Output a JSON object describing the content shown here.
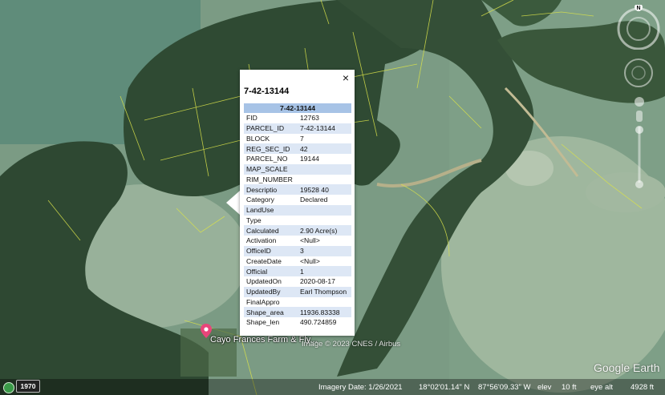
{
  "popup": {
    "title": "7-42-13144",
    "close_glyph": "×",
    "table_header": "7-42-13144",
    "rows": [
      {
        "key": "FID",
        "value": "12763"
      },
      {
        "key": "PARCEL_ID",
        "value": "7-42-13144"
      },
      {
        "key": "BLOCK",
        "value": "7"
      },
      {
        "key": "REG_SEC_ID",
        "value": "42"
      },
      {
        "key": "PARCEL_NO",
        "value": "19144"
      },
      {
        "key": "MAP_SCALE",
        "value": ""
      },
      {
        "key": "RIM_NUMBER",
        "value": ""
      },
      {
        "key": "Descriptio",
        "value": "19528 40"
      },
      {
        "key": "Category",
        "value": "Declared"
      },
      {
        "key": "LandUse",
        "value": ""
      },
      {
        "key": "Type",
        "value": ""
      },
      {
        "key": "Calculated",
        "value": "2.90 Acre(s)"
      },
      {
        "key": "Activation",
        "value": "<Null>"
      },
      {
        "key": "OfficeID",
        "value": "3"
      },
      {
        "key": "CreateDate",
        "value": "<Null>"
      },
      {
        "key": "Official",
        "value": "1"
      },
      {
        "key": "UpdatedOn",
        "value": "2020-08-17"
      },
      {
        "key": "UpdatedBy",
        "value": "Earl Thompson"
      },
      {
        "key": "FinalAppro",
        "value": ""
      },
      {
        "key": "Shape_area",
        "value": "11936.83338"
      },
      {
        "key": "Shape_len",
        "value": "490.724859"
      }
    ]
  },
  "map": {
    "place_label": "Cayo Frances Farm & Fly...",
    "copyright": "Image © 2023 CNES / Airbus",
    "brand": "Google Earth",
    "pin_icon": "map-pin-icon",
    "compass_north": "N"
  },
  "status_bar": {
    "historical_icon": "historical-imagery-icon",
    "year": "1970",
    "imagery_date": "Imagery Date: 1/26/2021",
    "lat": "18°02'01.14\" N",
    "lon": "87°56'09.33\" W",
    "elev_label": "elev",
    "elev_value": "10 ft",
    "eye_alt_label": "eye alt",
    "eye_alt_value": "4928 ft"
  },
  "colors": {
    "popup_header": "#a7c3e6",
    "popup_alt_row": "#dde7f5",
    "parcel_lines": "#d9e24a"
  }
}
